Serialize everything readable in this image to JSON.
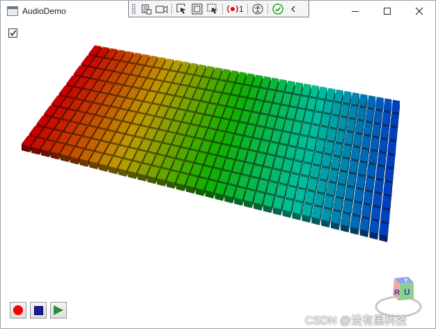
{
  "window": {
    "title": "AudioDemo",
    "icon": "app-window-icon"
  },
  "titlebar_buttons": [
    {
      "name": "minimize-button",
      "icon": "minimize-icon"
    },
    {
      "name": "maximize-button",
      "icon": "maximize-icon"
    },
    {
      "name": "close-button",
      "icon": "close-icon"
    }
  ],
  "debug_toolbar": {
    "items": [
      "live-visual-tree-icon",
      "camera-icon",
      "select-element-icon",
      "display-layout-adorners-icon",
      "track-focus-icon",
      "binding-failures-icon",
      "accessibility-icon",
      "hot-reload-ok-icon",
      "collapse-chevron-icon"
    ],
    "binding_failures_count": "1"
  },
  "checkbox": {
    "checked": true
  },
  "visualization": {
    "rows": 10,
    "columns": 38,
    "gradient_colors": [
      "#c80000",
      "#c09a00",
      "#10b000",
      "#00c0a0",
      "#0040c0"
    ]
  },
  "controls": [
    {
      "name": "record-button",
      "icon": "record-icon"
    },
    {
      "name": "stop-button",
      "icon": "stop-icon"
    },
    {
      "name": "play-button",
      "icon": "play-icon"
    }
  ],
  "watermark": {
    "text": "CSDN @没有黑科技"
  },
  "view_cube": {
    "labels": [
      "Y",
      "U",
      "R"
    ]
  }
}
